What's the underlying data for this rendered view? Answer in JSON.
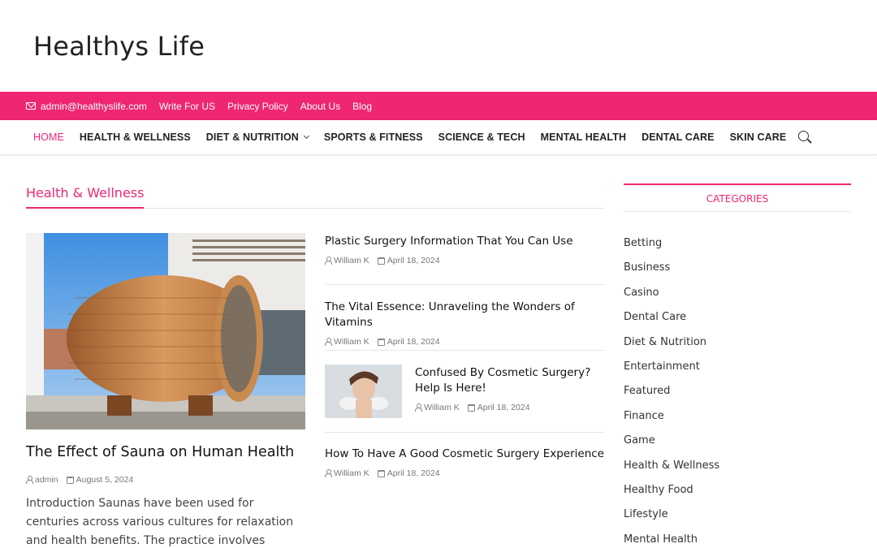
{
  "site": {
    "title": "Healthys Life"
  },
  "topbar": {
    "email": "admin@healthyslife.com",
    "links": [
      "Write For US",
      "Privacy Policy",
      "About Us",
      "Blog"
    ]
  },
  "nav": {
    "items": [
      "HOME",
      "HEALTH & WELLNESS",
      "DIET & NUTRITION",
      "SPORTS & FITNESS",
      "SCIENCE & TECH",
      "MENTAL HEALTH",
      "DENTAL CARE",
      "SKIN CARE"
    ],
    "active": "HOME",
    "accent": "#ef2672"
  },
  "section": {
    "title": "Health & Wellness"
  },
  "featured": {
    "title": "The Effect of Sauna on Human Health",
    "author": "admin",
    "date": "August 5, 2024",
    "excerpt": "Introduction Saunas have been used for centuries across various cultures for relaxation and health benefits. The practice involves exposing the body to"
  },
  "posts": [
    {
      "title": "Plastic Surgery Information That You Can Use",
      "author": "William K",
      "date": "April 18, 2024"
    },
    {
      "title": "The Vital Essence: Unraveling the Wonders of Vitamins",
      "author": "William K",
      "date": "April 18, 2024"
    },
    {
      "title": "Confused By Cosmetic Surgery? Help Is Here!",
      "author": "William K",
      "date": "April 18, 2024"
    },
    {
      "title": "How To Have A Good Cosmetic Surgery Experience",
      "author": "William K",
      "date": "April 18, 2024"
    }
  ],
  "sidebar": {
    "heading": "CATEGORIES",
    "categories": [
      "Betting",
      "Business",
      "Casino",
      "Dental Care",
      "Diet & Nutrition",
      "Entertainment",
      "Featured",
      "Finance",
      "Game",
      "Health & Wellness",
      "Healthy Food",
      "Lifestyle",
      "Mental Health"
    ]
  }
}
